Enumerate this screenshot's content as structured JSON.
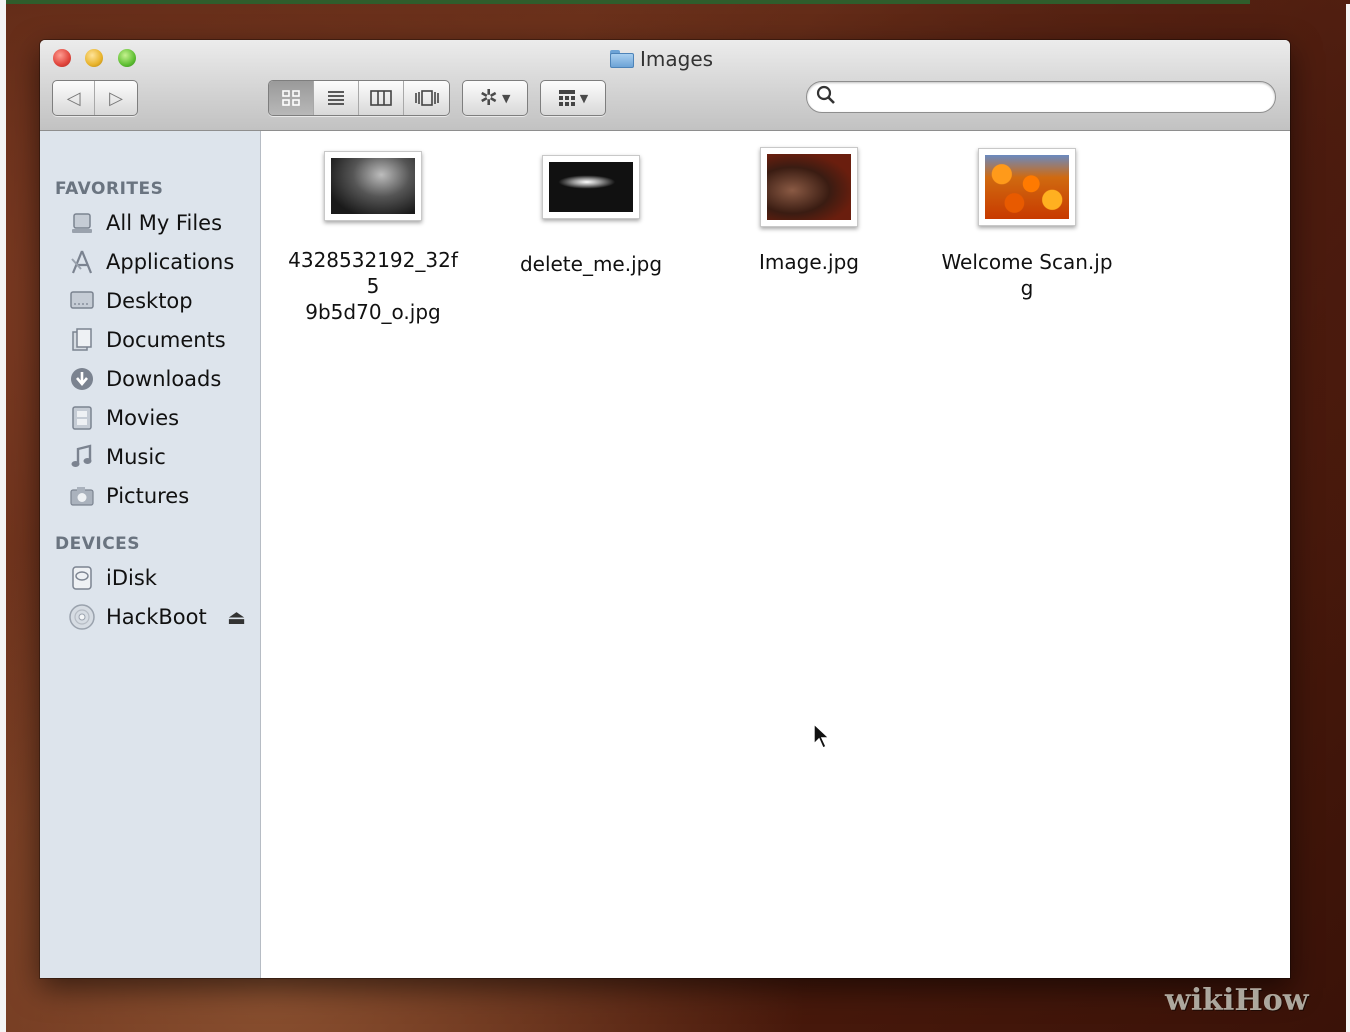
{
  "window": {
    "title": "Images"
  },
  "toolbar": {
    "back_icon": "back-arrow-icon",
    "forward_icon": "forward-arrow-icon",
    "view_modes": [
      "icon-view",
      "list-view",
      "column-view",
      "cover-flow-view"
    ],
    "active_view": "icon-view",
    "action_icon": "gear-icon",
    "arrange_icon": "arrange-grid-icon"
  },
  "search": {
    "value": "",
    "placeholder": ""
  },
  "sidebar": {
    "favorites_header": "FAVORITES",
    "favorites": [
      {
        "label": "All My Files",
        "icon": "all-files-icon"
      },
      {
        "label": "Applications",
        "icon": "applications-icon"
      },
      {
        "label": "Desktop",
        "icon": "desktop-icon"
      },
      {
        "label": "Documents",
        "icon": "documents-icon"
      },
      {
        "label": "Downloads",
        "icon": "downloads-icon"
      },
      {
        "label": "Movies",
        "icon": "movies-icon"
      },
      {
        "label": "Music",
        "icon": "music-icon"
      },
      {
        "label": "Pictures",
        "icon": "pictures-icon"
      }
    ],
    "devices_header": "DEVICES",
    "devices": [
      {
        "label": "iDisk",
        "icon": "idisk-icon"
      },
      {
        "label": "HackBoot",
        "icon": "disk-icon",
        "ejectable": true
      }
    ]
  },
  "files": [
    {
      "name": "4328532192_32f59b5d70_o.jpg",
      "line1": "4328532192_32f5",
      "line2": "9b5d70_o.jpg"
    },
    {
      "name": "delete_me.jpg",
      "line1": "delete_me.jpg",
      "line2": ""
    },
    {
      "name": "Image.jpg",
      "line1": "Image.jpg",
      "line2": ""
    },
    {
      "name": "Welcome Scan.jpg",
      "line1": "Welcome Scan.jpg",
      "line2": ""
    }
  ],
  "watermark": "wikiHow",
  "colors": {
    "sidebar_bg": "#dde4ec",
    "close": "#e0443b",
    "minimize": "#e8b32b",
    "zoom": "#5fbf33"
  }
}
